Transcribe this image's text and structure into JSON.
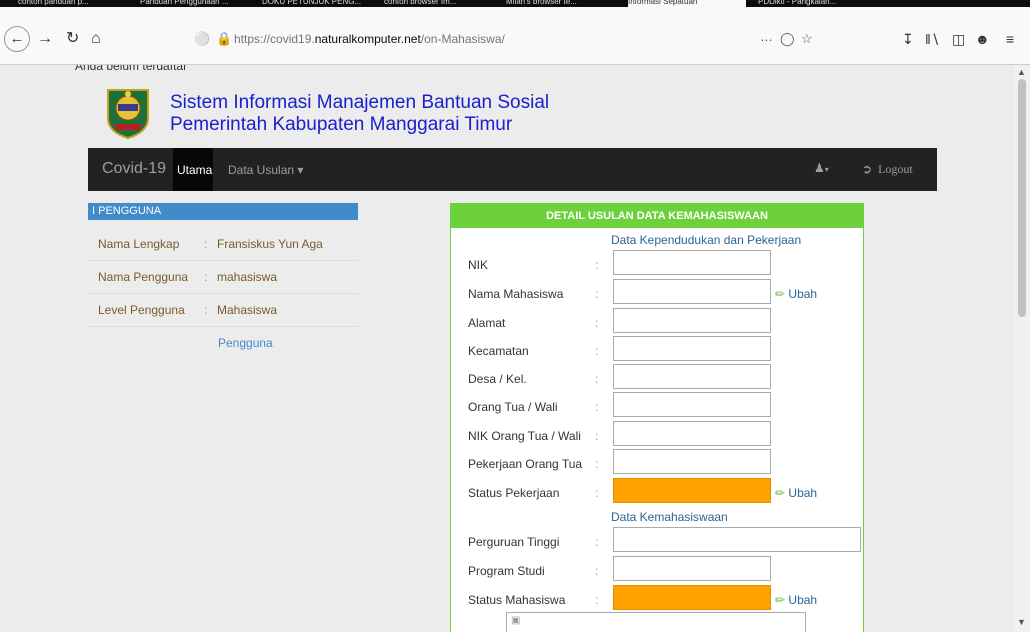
{
  "browser": {
    "tabs": [
      {
        "label": "contoh panduan p..."
      },
      {
        "label": "Panduan Penggunaan ..."
      },
      {
        "label": "DOKU PETUNJUK PENG..."
      },
      {
        "label": "contoh browser Im..."
      },
      {
        "label": "Milan's browser te..."
      },
      {
        "label": "Informasi Sepatuan"
      },
      {
        "label": "PDDikti - Pangkalan..."
      }
    ],
    "url_prefix": "https://covid19.",
    "url_domain": "naturalkomputer.net",
    "url_path": "/on-Mahasiswa/",
    "more_label": "…"
  },
  "page": {
    "anon_text": "Anda belum terdaftar",
    "title_line1": "Sistem Informasi Manajemen Bantuan Sosial",
    "title_line2": "Pemerintah Kabupaten Manggarai Timur"
  },
  "navbar": {
    "brand": "Covid-19",
    "active_item": "Utama",
    "dropdown": "Data Usulan",
    "logout": "Logout"
  },
  "user_info": {
    "heading": "I PENGGUNA",
    "rows": [
      {
        "key": "Nama Lengkap",
        "value": "Fransiskus Yun Aga"
      },
      {
        "key": "Nama Pengguna",
        "value": "mahasiswa"
      },
      {
        "key": "Level Pengguna",
        "value": "Mahasiswa"
      }
    ],
    "link": "Pengguna"
  },
  "form": {
    "header": "DETAIL USULAN DATA KEMAHASISWAAN",
    "section1": "Data Kependudukan dan Pekerjaan",
    "section2": "Data Kemahasiswaan",
    "edit_label": "Ubah",
    "fields": [
      {
        "label": "NIK"
      },
      {
        "label": "Nama Mahasiswa"
      },
      {
        "label": "Alamat"
      },
      {
        "label": "Kecamatan"
      },
      {
        "label": "Desa / Kel."
      },
      {
        "label": "Orang Tua / Wali"
      },
      {
        "label": "NIK Orang Tua / Wali"
      },
      {
        "label": "Pekerjaan Orang Tua"
      },
      {
        "label": "Status Pekerjaan"
      },
      {
        "label": "Perguruan Tinggi"
      },
      {
        "label": "Program Studi"
      },
      {
        "label": "Status Mahasiswa"
      }
    ]
  },
  "colors": {
    "navbar": "#222222",
    "form_accent": "#6cd13c",
    "status_fill": "#ffa200",
    "title_blue": "#1a20cc"
  }
}
